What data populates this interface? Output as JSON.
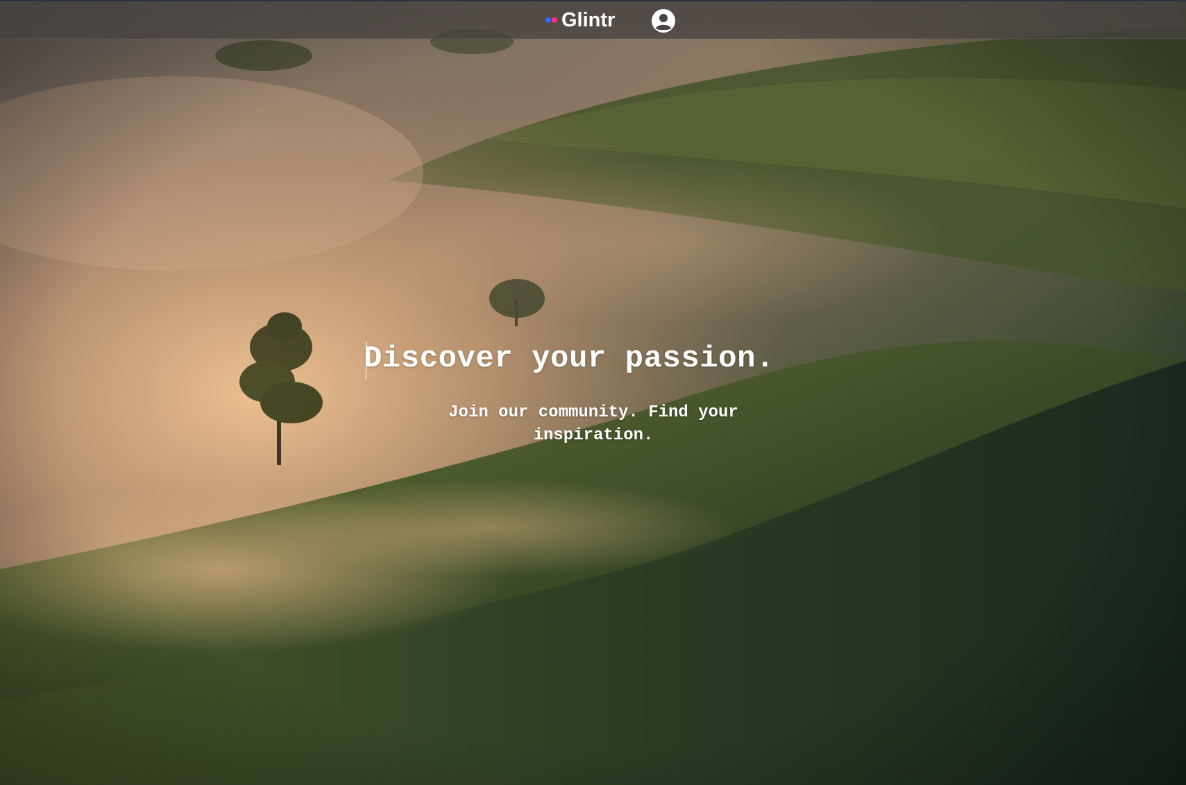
{
  "header": {
    "logo_text": "Glintr",
    "logo_dot_colors": [
      "#2f6bff",
      "#ff2d86"
    ],
    "avatar_icon": "user-circle-icon"
  },
  "hero": {
    "headline": "Discover your passion.",
    "subheadline": "Join our community. Find your inspiration."
  },
  "colors": {
    "header_bg": "#4a4442",
    "text": "#ffffff"
  }
}
